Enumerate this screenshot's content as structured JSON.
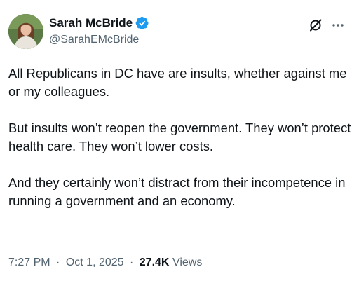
{
  "author": {
    "display_name": "Sarah McBride",
    "handle": "@SarahEMcBride",
    "verified": true
  },
  "tweet": {
    "paragraphs": [
      "All Republicans in DC have are insults, whether against me or my colleagues.",
      "But insults won’t reopen the government. They won’t protect health care. They won’t lower costs.",
      "And they certainly won’t distract from their incompetence in running a government and an economy."
    ]
  },
  "meta": {
    "time": "7:27 PM",
    "separator": "·",
    "date": "Oct 1, 2025",
    "views_count": "27.4K",
    "views_label": "Views"
  },
  "colors": {
    "verified_badge": "#1d9bf0",
    "secondary_text": "#536471",
    "primary_text": "#0f1419"
  },
  "icons": {
    "verified": "verified-badge-icon",
    "grok": "grok-icon",
    "more": "more-options-icon"
  }
}
